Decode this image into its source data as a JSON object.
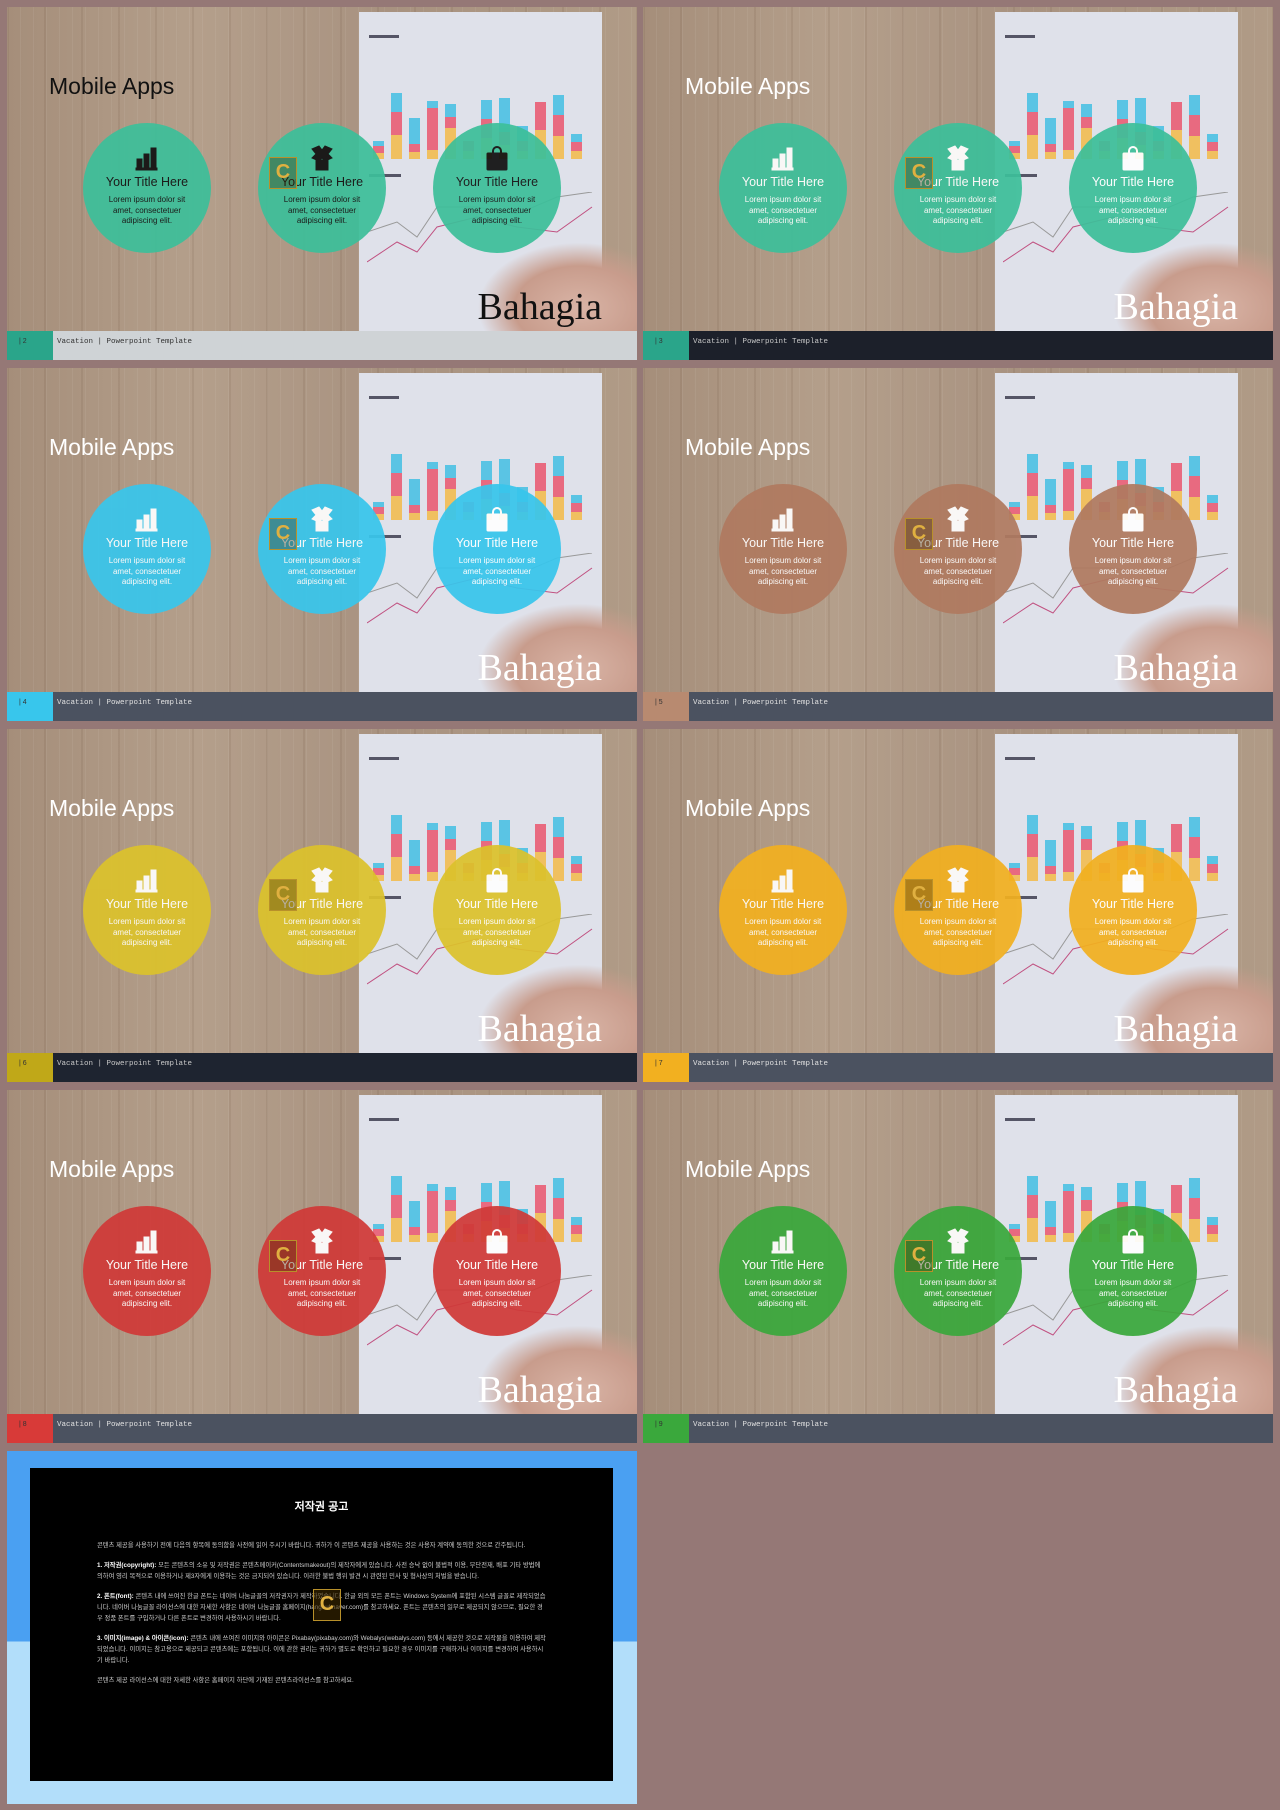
{
  "slides": [
    {
      "page": "2",
      "title": "Mobile Apps",
      "brand": "Bahagia",
      "footer_label": "Vacation | Powerpoint Template",
      "circle_color": "#3dbf9a",
      "footer_color": "#cfd3d6",
      "page_color": "#2aa58a",
      "text_color": "#111111",
      "footer_text_color": "#333333",
      "items": [
        {
          "icon": "bar-chart-icon",
          "title": "Your Title Here",
          "body": "Lorem ipsum dolor sit amet, consectetuer adipiscing elit."
        },
        {
          "icon": "open-box-icon",
          "title": "Your Title Here",
          "body": "Lorem ipsum dolor sit amet, consectetuer adipiscing elit."
        },
        {
          "icon": "shopping-bag-icon",
          "title": "Your Title Here",
          "body": "Lorem ipsum dolor sit amet, consectetuer adipiscing elit."
        }
      ]
    },
    {
      "page": "3",
      "title": "Mobile Apps",
      "brand": "Bahagia",
      "footer_label": "Vacation | Powerpoint Template",
      "circle_color": "#3dbf9a",
      "footer_color": "#1c202a",
      "page_color": "#2aa58a",
      "text_color": "#ffffff",
      "footer_text_color": "#c8c8c8",
      "items": [
        {
          "icon": "bar-chart-icon",
          "title": "Your Title Here",
          "body": "Lorem ipsum dolor sit amet, consectetuer adipiscing elit."
        },
        {
          "icon": "open-box-icon",
          "title": "Your Title Here",
          "body": "Lorem ipsum dolor sit amet, consectetuer adipiscing elit."
        },
        {
          "icon": "shopping-bag-icon",
          "title": "Your Title Here",
          "body": "Lorem ipsum dolor sit amet, consectetuer adipiscing elit."
        }
      ]
    },
    {
      "page": "4",
      "title": "Mobile Apps",
      "brand": "Bahagia",
      "footer_label": "Vacation | Powerpoint Template",
      "circle_color": "#38c6ec",
      "footer_color": "#4b5260",
      "page_color": "#38c6ec",
      "text_color": "#ffffff",
      "footer_text_color": "#e0e0e0",
      "items": [
        {
          "icon": "bar-chart-icon",
          "title": "Your Title Here",
          "body": "Lorem ipsum dolor sit amet, consectetuer adipiscing elit."
        },
        {
          "icon": "open-box-icon",
          "title": "Your Title Here",
          "body": "Lorem ipsum dolor sit amet, consectetuer adipiscing elit."
        },
        {
          "icon": "shopping-bag-icon",
          "title": "Your Title Here",
          "body": "Lorem ipsum dolor sit amet, consectetuer adipiscing elit."
        }
      ]
    },
    {
      "page": "5",
      "title": "Mobile Apps",
      "brand": "Bahagia",
      "footer_label": "Vacation | Powerpoint Template",
      "circle_color": "#b07a60",
      "footer_color": "#4b5260",
      "page_color": "#b88a70",
      "text_color": "#ffffff",
      "footer_text_color": "#e0e0e0",
      "items": [
        {
          "icon": "bar-chart-icon",
          "title": "Your Title Here",
          "body": "Lorem ipsum dolor sit amet, consectetuer adipiscing elit."
        },
        {
          "icon": "open-box-icon",
          "title": "Your Title Here",
          "body": "Lorem ipsum dolor sit amet, consectetuer adipiscing elit."
        },
        {
          "icon": "shopping-bag-icon",
          "title": "Your Title Here",
          "body": "Lorem ipsum dolor sit amet, consectetuer adipiscing elit."
        }
      ]
    },
    {
      "page": "6",
      "title": "Mobile Apps",
      "brand": "Bahagia",
      "footer_label": "Vacation | Powerpoint Template",
      "circle_color": "#dcc22c",
      "footer_color": "#1e2430",
      "page_color": "#c0a818",
      "text_color": "#ffffff",
      "footer_text_color": "#c8c8c8",
      "items": [
        {
          "icon": "bar-chart-icon",
          "title": "Your Title Here",
          "body": "Lorem ipsum dolor sit amet, consectetuer adipiscing elit."
        },
        {
          "icon": "open-box-icon",
          "title": "Your Title Here",
          "body": "Lorem ipsum dolor sit amet, consectetuer adipiscing elit."
        },
        {
          "icon": "shopping-bag-icon",
          "title": "Your Title Here",
          "body": "Lorem ipsum dolor sit amet, consectetuer adipiscing elit."
        }
      ]
    },
    {
      "page": "7",
      "title": "Mobile Apps",
      "brand": "Bahagia",
      "footer_label": "Vacation | Powerpoint Template",
      "circle_color": "#f2b020",
      "footer_color": "#4b5260",
      "page_color": "#f2b020",
      "text_color": "#ffffff",
      "footer_text_color": "#e0e0e0",
      "items": [
        {
          "icon": "bar-chart-icon",
          "title": "Your Title Here",
          "body": "Lorem ipsum dolor sit amet, consectetuer adipiscing elit."
        },
        {
          "icon": "open-box-icon",
          "title": "Your Title Here",
          "body": "Lorem ipsum dolor sit amet, consectetuer adipiscing elit."
        },
        {
          "icon": "shopping-bag-icon",
          "title": "Your Title Here",
          "body": "Lorem ipsum dolor sit amet, consectetuer adipiscing elit."
        }
      ]
    },
    {
      "page": "8",
      "title": "Mobile Apps",
      "brand": "Bahagia",
      "footer_label": "Vacation | Powerpoint Template",
      "circle_color": "#d03a38",
      "footer_color": "#4b5260",
      "page_color": "#d83a38",
      "text_color": "#ffffff",
      "footer_text_color": "#e0e0e0",
      "items": [
        {
          "icon": "bar-chart-icon",
          "title": "Your Title Here",
          "body": "Lorem ipsum dolor sit amet, consectetuer adipiscing elit."
        },
        {
          "icon": "open-box-icon",
          "title": "Your Title Here",
          "body": "Lorem ipsum dolor sit amet, consectetuer adipiscing elit."
        },
        {
          "icon": "shopping-bag-icon",
          "title": "Your Title Here",
          "body": "Lorem ipsum dolor sit amet, consectetuer adipiscing elit."
        }
      ]
    },
    {
      "page": "9",
      "title": "Mobile Apps",
      "brand": "Bahagia",
      "footer_label": "Vacation | Powerpoint Template",
      "circle_color": "#3aa83c",
      "footer_color": "#4b5260",
      "page_color": "#3aa83c",
      "text_color": "#ffffff",
      "footer_text_color": "#e0e0e0",
      "items": [
        {
          "icon": "bar-chart-icon",
          "title": "Your Title Here",
          "body": "Lorem ipsum dolor sit amet, consectetuer adipiscing elit."
        },
        {
          "icon": "open-box-icon",
          "title": "Your Title Here",
          "body": "Lorem ipsum dolor sit amet, consectetuer adipiscing elit."
        },
        {
          "icon": "shopping-bag-icon",
          "title": "Your Title Here",
          "body": "Lorem ipsum dolor sit amet, consectetuer adipiscing elit."
        }
      ]
    }
  ],
  "copyright": {
    "title": "저작권 공고",
    "intro": "콘텐츠 제공을 사용하기 전에 다음의 항목에 동의함을 사전에 읽어 주시기 바랍니다. 귀하가 이 콘텐츠 제공을 사용하는 것은 사용자 계약에 동의한 것으로 간주됩니다.",
    "sections": [
      {
        "label": "1. 저작권(copyright):",
        "text": "모든 콘텐츠의 소유 및 저작권은 콘텐츠메이커(Contentsmakeout)의 제작자에게 있습니다. 사전 승낙 없이 불법적 이용, 무단전재, 배포 기타 방법에 의하여 영리 목적으로 이용하거나 제3자에게 이용하는 것은 금지되어 있습니다. 이러한 불법 행위 발견 시 관련된 민사 및 형사상의 처벌을 받습니다."
      },
      {
        "label": "2. 폰트(font):",
        "text": "콘텐츠 내에 쓰여진 한글 폰트는 네이버 나눔글꼴의 저작권자가 제작하였습니다. 한글 외의 모든 폰트는 Windows System에 포함된 시스템 글꼴로 제작되었습니다. 네이버 나눔글꼴 라이선스에 대한 자세한 사항은 네이버 나눔글꼴 홈페이지(hangeul.naver.com)를 참고하세요. 폰트는 콘텐츠의 일부로 제공되지 않으므로, 필요한 경우 정품 폰트를 구입하거나 다른 폰트로 변경하여 사용하시기 바랍니다."
      },
      {
        "label": "3. 이미지(image) & 아이콘(icon):",
        "text": "콘텐츠 내에 쓰여진 이미지와 아이콘은 Pixabay(pixabay.com)와 Webalys(webalys.com) 등에서 제공한 것으로 저작물을 이용하여 제작되었습니다. 이미지는 참고용으로 제공되고 콘텐츠에는 포함됩니다. 이에 관한 권리는 귀하가 별도로 확인하고 필요한 경우 이미지를 구매하거나 이미지를 변경하여 사용하시기 바랍니다."
      }
    ],
    "outro": "콘텐츠 제공 라이선스에 대한 자세한 사항은 홈페이지 하단에 기재된 콘텐츠라이선스를 참고하세요.",
    "outer_top_color": "#4aa0f2",
    "outer_bottom_color": "#b2defa"
  }
}
